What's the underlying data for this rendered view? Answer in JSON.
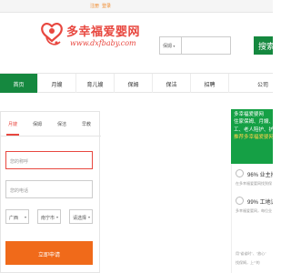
{
  "topbar": {
    "register": "注册",
    "login": "登录"
  },
  "logo": {
    "title": "多幸福爱婴网",
    "subtitle": "www.dxfbaby.com"
  },
  "search": {
    "category": "保姆",
    "button_label": "搜索"
  },
  "nav": {
    "items": [
      {
        "label": "首页"
      },
      {
        "label": "月嫂"
      },
      {
        "label": "育儿嫂"
      },
      {
        "label": "保姆"
      },
      {
        "label": "保洁"
      },
      {
        "label": "招聘"
      },
      {
        "label": "公司"
      }
    ]
  },
  "form": {
    "tabs": [
      {
        "label": "月嫂"
      },
      {
        "label": "保姆"
      },
      {
        "label": "保洁"
      },
      {
        "label": "早教"
      }
    ],
    "name_placeholder": "您的称呼",
    "phone_placeholder": "您的电话",
    "province": "广西",
    "city": "南宁市",
    "district": "请选择",
    "submit_label": "立即申请"
  },
  "promo": {
    "lines": [
      "多幸福爱婴网",
      "住家保姆、月嫂、育",
      "工、老人陪护、护工",
      "推荐多幸福爱婴网"
    ]
  },
  "stats": {
    "items": [
      {
        "value": "96% 业主按",
        "desc": "在多幸福爱婴网找到保"
      },
      {
        "value": "99% 工地证",
        "desc": "多幸福爱婴网，每位业"
      }
    ],
    "footer_text": "用\"省省时\"、\"放心\"",
    "footer_text2": "找保姆，上“”的"
  },
  "colors": {
    "brand_green": "#15883f",
    "brand_red": "#e8473f",
    "cta_orange": "#f06a1a",
    "promo_green": "#15a045"
  }
}
